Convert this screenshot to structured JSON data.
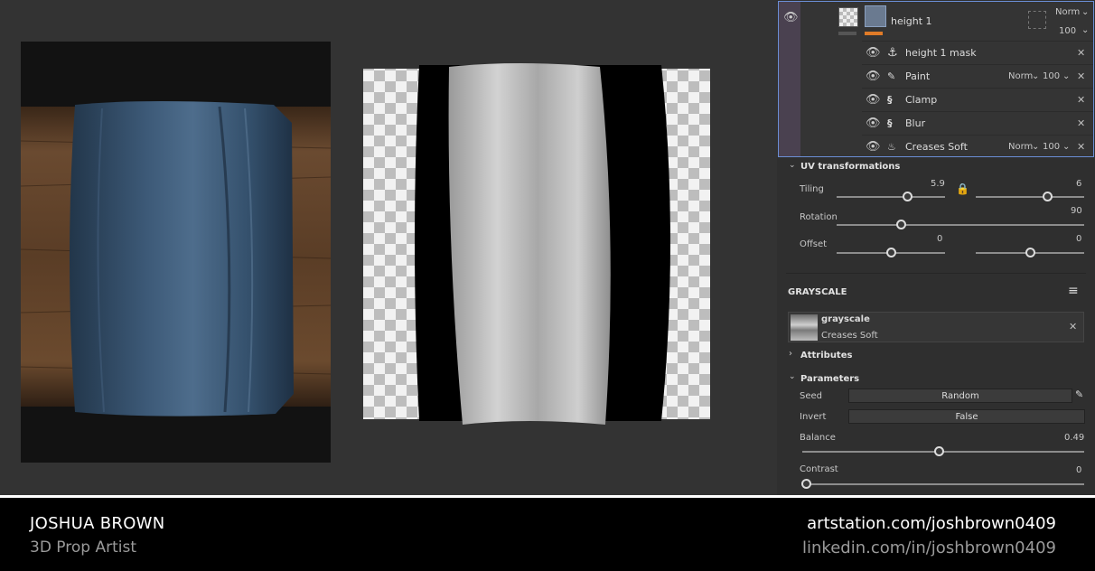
{
  "layers": {
    "main": {
      "name": "height 1",
      "blend": "Norm",
      "opacity": "100"
    },
    "effects": [
      {
        "name": "height 1 mask",
        "blend": "",
        "opacity": "",
        "icon": "anchor-icon"
      },
      {
        "name": "Paint",
        "blend": "Norm",
        "opacity": "100",
        "icon": "brush-icon"
      },
      {
        "name": "Clamp",
        "blend": "",
        "opacity": "",
        "icon": "filter-icon"
      },
      {
        "name": "Blur",
        "blend": "",
        "opacity": "",
        "icon": "filter-icon"
      },
      {
        "name": "Creases Soft",
        "blend": "Norm",
        "opacity": "100",
        "icon": "fill-icon"
      }
    ]
  },
  "uv": {
    "title": "UV transformations",
    "tiling_label": "Tiling",
    "tiling_u": "5.9",
    "tiling_v": "6",
    "rotation_label": "Rotation",
    "rotation": "90",
    "offset_label": "Offset",
    "offset_u": "0",
    "offset_v": "0"
  },
  "grayscale": {
    "title": "GRAYSCALE",
    "resource_name": "grayscale",
    "resource_sub": "Creases Soft",
    "attributes": "Attributes",
    "parameters": "Parameters",
    "seed_label": "Seed",
    "seed_value": "Random",
    "invert_label": "Invert",
    "invert_value": "False",
    "balance_label": "Balance",
    "balance_value": "0.49",
    "contrast_label": "Contrast",
    "contrast_value": "0"
  },
  "footer": {
    "name": "JOSHUA BROWN",
    "role": "3D Prop Artist",
    "link1": "artstation.com/joshbrown0409",
    "link2": "linkedin.com/in/joshbrown0409"
  },
  "colors": {
    "accent": "#6b8fd6",
    "orange": "#e07b28",
    "footer_bg": "#000000",
    "panel_bg": "#2f2f2f"
  }
}
